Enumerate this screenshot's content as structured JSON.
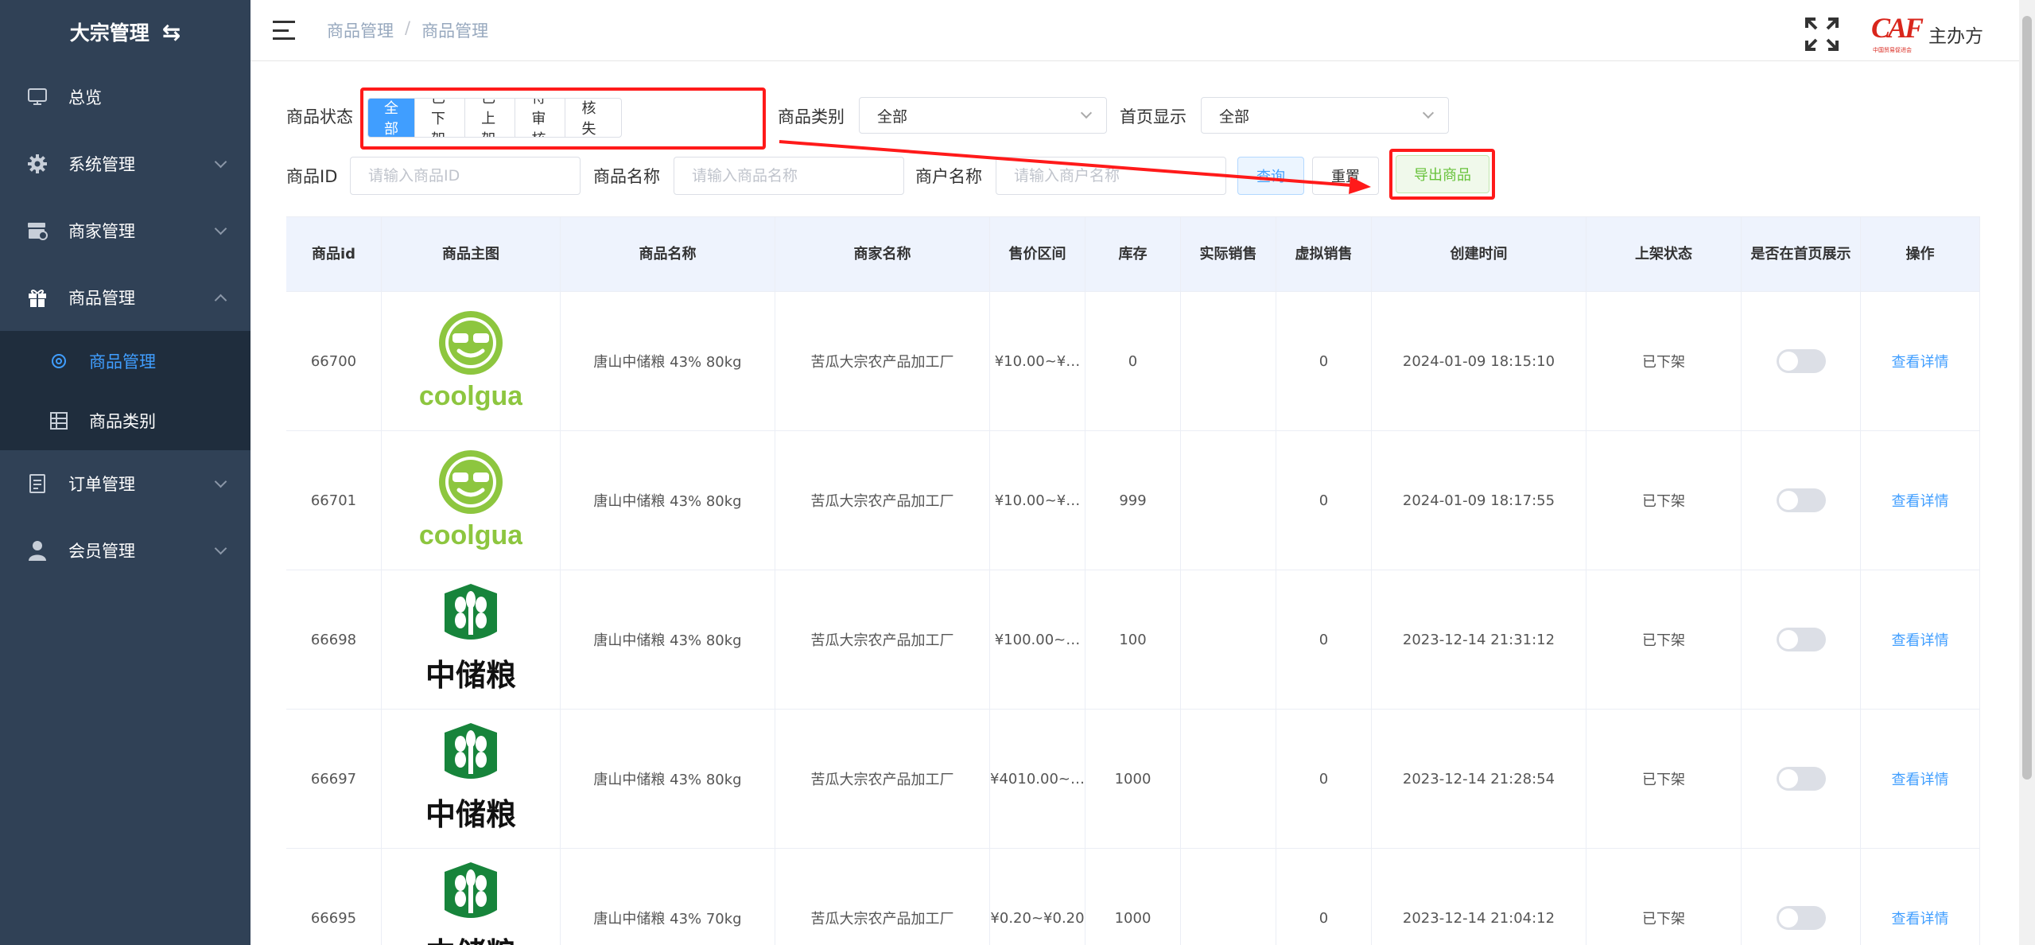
{
  "sidebar": {
    "title": "大宗管理",
    "items": [
      {
        "label": "总览"
      },
      {
        "label": "系统管理"
      },
      {
        "label": "商家管理"
      },
      {
        "label": "商品管理"
      },
      {
        "label": "订单管理"
      },
      {
        "label": "会员管理"
      }
    ],
    "sub_items": [
      {
        "label": "商品管理"
      },
      {
        "label": "商品类别"
      }
    ]
  },
  "navbar": {
    "breadcrumb": [
      "商品管理",
      "商品管理"
    ],
    "sep": "/",
    "org_label": "主办方",
    "logo_text": "CAF",
    "logo_sub": "中国贸易促进会"
  },
  "filters": {
    "status_label": "商品状态",
    "status_options": [
      "全部",
      "已下架",
      "已上架",
      "待审核",
      "审核失败"
    ],
    "category_label": "商品类别",
    "category_value": "全部",
    "home_label": "首页显示",
    "home_value": "全部",
    "id_label": "商品ID",
    "id_placeholder": "请输入商品ID",
    "name_label": "商品名称",
    "name_placeholder": "请输入商品名称",
    "merchant_label": "商户名称",
    "merchant_placeholder": "请输入商户名称",
    "query": "查询",
    "reset": "重置",
    "export": "导出商品"
  },
  "table": {
    "headers": [
      "商品id",
      "商品主图",
      "商品名称",
      "商家名称",
      "售价区间",
      "库存",
      "实际销售",
      "虚拟销售",
      "创建时间",
      "上架状态",
      "是否在首页展示",
      "操作"
    ],
    "rows": [
      {
        "id": "66700",
        "img": "coolgua",
        "name": "唐山中储粮 43% 80kg",
        "merchant": "苦瓜大宗农产品加工厂",
        "price": "¥10.00~¥…",
        "stock": "0",
        "real": "",
        "virtual": "0",
        "created": "2024-01-09 18:15:10",
        "status": "已下架",
        "action": "查看详情"
      },
      {
        "id": "66701",
        "img": "coolgua",
        "name": "唐山中储粮 43% 80kg",
        "merchant": "苦瓜大宗农产品加工厂",
        "price": "¥10.00~¥…",
        "stock": "999",
        "real": "",
        "virtual": "0",
        "created": "2024-01-09 18:17:55",
        "status": "已下架",
        "action": "查看详情"
      },
      {
        "id": "66698",
        "img": "sinograin",
        "name": "唐山中储粮 43% 80kg",
        "merchant": "苦瓜大宗农产品加工厂",
        "price": "¥100.00~…",
        "stock": "100",
        "real": "",
        "virtual": "0",
        "created": "2023-12-14 21:31:12",
        "status": "已下架",
        "action": "查看详情"
      },
      {
        "id": "66697",
        "img": "sinograin",
        "name": "唐山中储粮 43% 80kg",
        "merchant": "苦瓜大宗农产品加工厂",
        "price": "¥4010.00~…",
        "stock": "1000",
        "real": "",
        "virtual": "0",
        "created": "2023-12-14 21:28:54",
        "status": "已下架",
        "action": "查看详情"
      },
      {
        "id": "66695",
        "img": "sinograin",
        "name": "唐山中储粮 43% 70kg",
        "merchant": "苦瓜大宗农产品加工厂",
        "price": "¥0.20~¥0.20",
        "stock": "1000",
        "real": "",
        "virtual": "0",
        "created": "2023-12-14 21:04:12",
        "status": "已下架",
        "action": "查看详情"
      }
    ]
  },
  "logos": {
    "coolgua": "coolgua",
    "sinograin": "中储粮"
  },
  "colors": {
    "sidebar": "#304156",
    "accent": "#409eff",
    "annotation": "#ff1a1a"
  }
}
